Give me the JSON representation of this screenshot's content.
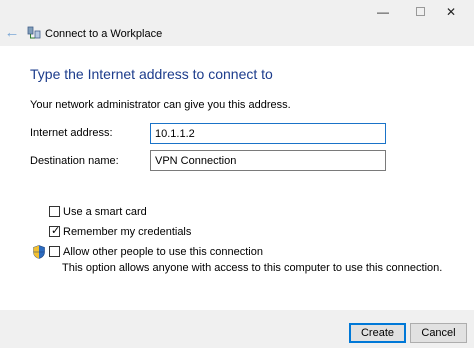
{
  "window": {
    "title": "Connect to a Workplace",
    "back_icon": "back-arrow-icon",
    "minimize_icon": "minimize-icon",
    "maximize_icon": "maximize-icon",
    "close_icon": "close-icon"
  },
  "main": {
    "heading": "Type the Internet address to connect to",
    "info": "Your network administrator can give you this address.",
    "internet_address": {
      "label": "Internet address:",
      "value": "10.1.1.2"
    },
    "destination_name": {
      "label": "Destination name:",
      "value": "VPN Connection"
    },
    "options": {
      "smart_card": {
        "label": "Use a smart card",
        "checked": false
      },
      "remember": {
        "label": "Remember my credentials",
        "checked": true
      },
      "allow_others": {
        "label": "Allow other people to use this connection",
        "checked": false,
        "description": "This option allows anyone with access to this computer to use this connection."
      }
    }
  },
  "footer": {
    "create_label": "Create",
    "cancel_label": "Cancel"
  },
  "colors": {
    "heading": "#1c3c8c",
    "accent": "#0078d7",
    "background": "#ffffff",
    "chrome": "#f0f0f0"
  }
}
